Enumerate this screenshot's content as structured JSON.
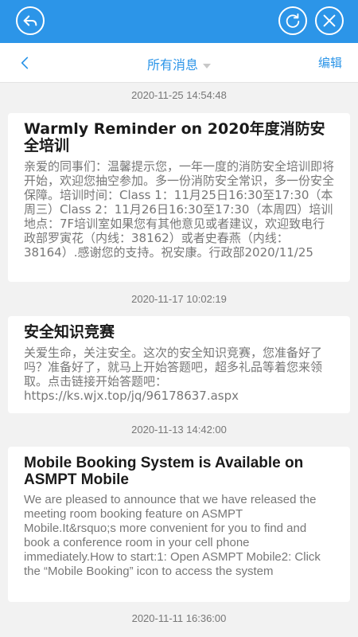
{
  "header": {
    "icons": [
      "back-arrow-icon",
      "refresh-icon",
      "close-icon"
    ],
    "color": "#2c95e8"
  },
  "navbar": {
    "back_icon": "chevron-left-icon",
    "title": "所有消息",
    "edit_label": "编辑"
  },
  "messages": [
    {
      "timestamp": "2020-11-25 14:54:48",
      "title": "Warmly Reminder on 2020年度消防安全培训",
      "body": "亲爱的同事们：温馨提示您，一年一度的消防安全培训即将开始，欢迎您抽空参加。多一份消防安全常识，多一份安全保障。培训时间：Class 1：11月25日16:30至17:30（本周三）Class 2：11月26日16:30至17:30（本周四）培训地点：7F培训室如果您有其他意见或者建议，欢迎致电行政部罗寅花（内线：38162）或者史春燕（内线：38164）.感谢您的支持。祝安康。行政部2020/11/25"
    },
    {
      "timestamp": "2020-11-17 10:02:19",
      "title": "安全知识竞赛",
      "body": "关爱生命，关注安全。这次的安全知识竞赛，您准备好了吗？准备好了，就马上开始答题吧，超多礼品等着您来领取。点击链接开始答题吧：https://ks.wjx.top/jq/96178637.aspx"
    },
    {
      "timestamp": "2020-11-13 14:42:00",
      "title": "Mobile Booking System is Available on ASMPT Mobile",
      "body": "We are pleased to announce that we have released the meeting room booking feature on ASMPT Mobile.It&rsquo;s more convenient for you to find and book a conference room in your cell phone immediately.How to start:1: Open ASMPT Mobile2: Click the “Mobile Booking” icon to access the system"
    },
    {
      "timestamp": "2020-11-11 16:36:00"
    }
  ]
}
